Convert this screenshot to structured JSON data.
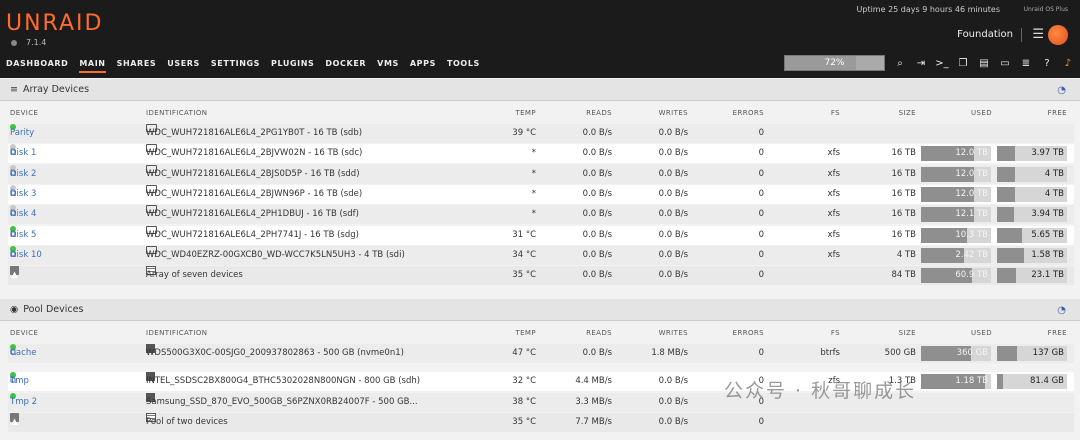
{
  "app": {
    "logo": "UNRAID",
    "version": "7.1.4",
    "uptime": "Uptime 25 days 9 hours 46 minutes",
    "plan": "Unraid OS Plus",
    "server_name": "Foundation",
    "accent": "#ff6c2c"
  },
  "nav": [
    "DASHBOARD",
    "MAIN",
    "SHARES",
    "USERS",
    "SETTINGS",
    "PLUGINS",
    "DOCKER",
    "VMS",
    "APPS",
    "TOOLS"
  ],
  "usage": {
    "label": "72%",
    "fraction": 0.72
  },
  "columns": [
    "DEVICE",
    "IDENTIFICATION",
    "TEMP",
    "READS",
    "WRITES",
    "ERRORS",
    "FS",
    "SIZE",
    "USED",
    "FREE"
  ],
  "array": {
    "title": "Array Devices",
    "rows": [
      {
        "device": "Parity",
        "status": "green",
        "link": false,
        "id": "WDC_WUH721816ALE6L4_2PG1YB0T - 16 TB (sdb)",
        "temp": "39 °C",
        "reads": "0.0 B/s",
        "writes": "0.0 B/s",
        "errors": "0",
        "fs": "",
        "size": "",
        "used": "",
        "free": "",
        "used_frac": 0
      },
      {
        "device": "Disk 1",
        "status": "grey",
        "link": true,
        "id": "WDC_WUH721816ALE6L4_2BJVW02N - 16 TB (sdc)",
        "temp": "*",
        "reads": "0.0 B/s",
        "writes": "0.0 B/s",
        "errors": "0",
        "fs": "xfs",
        "size": "16 TB",
        "used": "12.0 TB",
        "free": "3.97 TB",
        "used_frac": 0.75
      },
      {
        "device": "Disk 2",
        "status": "grey",
        "link": true,
        "id": "WDC_WUH721816ALE6L4_2BJS0D5P - 16 TB (sdd)",
        "temp": "*",
        "reads": "0.0 B/s",
        "writes": "0.0 B/s",
        "errors": "0",
        "fs": "xfs",
        "size": "16 TB",
        "used": "12.0 TB",
        "free": "4 TB",
        "used_frac": 0.75
      },
      {
        "device": "Disk 3",
        "status": "grey",
        "link": true,
        "id": "WDC_WUH721816ALE6L4_2BJWN96P - 16 TB (sde)",
        "temp": "*",
        "reads": "0.0 B/s",
        "writes": "0.0 B/s",
        "errors": "0",
        "fs": "xfs",
        "size": "16 TB",
        "used": "12.0 TB",
        "free": "4 TB",
        "used_frac": 0.75
      },
      {
        "device": "Disk 4",
        "status": "grey",
        "link": true,
        "id": "WDC_WUH721816ALE6L4_2PH1DBUJ - 16 TB (sdf)",
        "temp": "*",
        "reads": "0.0 B/s",
        "writes": "0.0 B/s",
        "errors": "0",
        "fs": "xfs",
        "size": "16 TB",
        "used": "12.1 TB",
        "free": "3.94 TB",
        "used_frac": 0.76
      },
      {
        "device": "Disk 5",
        "status": "green",
        "link": true,
        "id": "WDC_WUH721816ALE6L4_2PH7741J - 16 TB (sdg)",
        "temp": "31 °C",
        "reads": "0.0 B/s",
        "writes": "0.0 B/s",
        "errors": "0",
        "fs": "xfs",
        "size": "16 TB",
        "used": "10.3 TB",
        "free": "5.65 TB",
        "used_frac": 0.65
      },
      {
        "device": "Disk 10",
        "status": "green",
        "link": true,
        "id": "WDC_WD40EZRZ-00GXCB0_WD-WCC7K5LN5UH3 - 4 TB (sdi)",
        "temp": "34 °C",
        "reads": "0.0 B/s",
        "writes": "0.0 B/s",
        "errors": "0",
        "fs": "xfs",
        "size": "4 TB",
        "used": "2.42 TB",
        "free": "1.58 TB",
        "used_frac": 0.61
      }
    ],
    "total": {
      "id": "Array of seven devices",
      "temp": "35 °C",
      "reads": "0.0 B/s",
      "writes": "0.0 B/s",
      "errors": "0",
      "size": "84 TB",
      "used": "60.9 TB",
      "free": "23.1 TB",
      "used_frac": 0.73
    }
  },
  "pool": {
    "title": "Pool Devices",
    "rows": [
      {
        "device": "Cache",
        "status": "green",
        "link": true,
        "id": "WDS500G3X0C-00SJG0_200937802863 - 500 GB (nvme0n1)",
        "temp": "47 °C",
        "reads": "0.0 B/s",
        "writes": "1.8 MB/s",
        "errors": "0",
        "fs": "btrfs",
        "size": "500 GB",
        "used": "360 GB",
        "free": "137 GB",
        "used_frac": 0.72
      },
      {
        "device": "Tmp",
        "status": "green",
        "link": true,
        "id": "INTEL_SSDSC2BX800G4_BTHC5302028N800NGN - 800 GB (sdh)",
        "temp": "32 °C",
        "reads": "4.4 MB/s",
        "writes": "0.0 B/s",
        "errors": "0",
        "fs": "zfs",
        "size": "1.3 TB",
        "used": "1.18 TB",
        "free": "81.4 GB",
        "used_frac": 0.92
      },
      {
        "device": "Tmp 2",
        "status": "green",
        "link": false,
        "id": "Samsung_SSD_870_EVO_500GB_S6PZNX0RB24007F - 500 GB...",
        "temp": "38 °C",
        "reads": "3.3 MB/s",
        "writes": "0.0 B/s",
        "errors": "0",
        "fs": "",
        "size": "",
        "used": "",
        "free": "",
        "used_frac": 0
      }
    ],
    "total": {
      "id": "Pool of two devices",
      "temp": "35 °C",
      "reads": "7.7 MB/s",
      "writes": "0.0 B/s",
      "errors": "0",
      "size": "",
      "used": "",
      "free": "",
      "used_frac": 0
    }
  },
  "watermark": "公众号 · 秋哥聊成长"
}
